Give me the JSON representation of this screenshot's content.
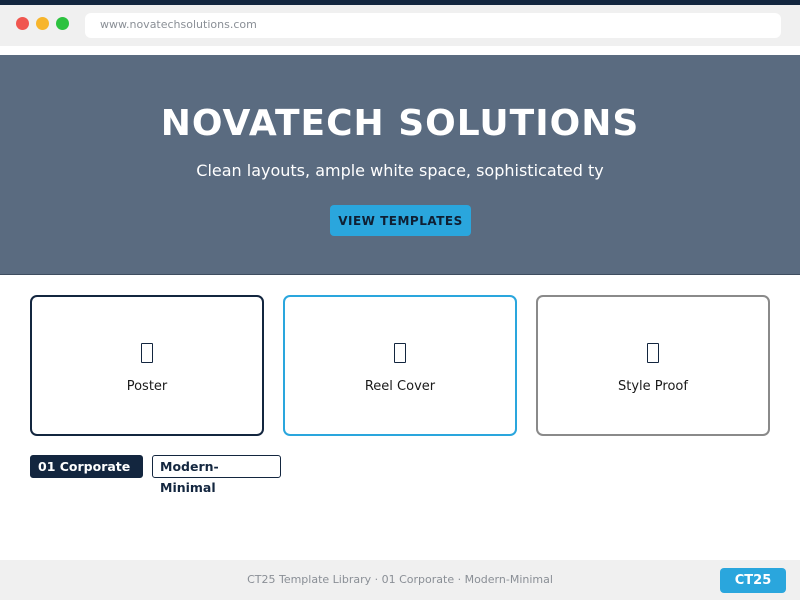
{
  "browser": {
    "url": "www.novatechsolutions.com"
  },
  "hero": {
    "title": "NOVATECH SOLUTIONS",
    "subtitle": "Clean layouts, ample white space, sophisticated ty",
    "button_label": "VIEW TEMPLATES"
  },
  "cards": [
    {
      "label": "Poster",
      "icon": "document-icon"
    },
    {
      "label": "Reel Cover",
      "icon": "document-icon"
    },
    {
      "label": "Style Proof",
      "icon": "document-icon"
    }
  ],
  "tags": [
    {
      "label": "01 Corporate"
    },
    {
      "label": "Modern-Minimal"
    }
  ],
  "footer": {
    "text": "CT25 Template Library · 01 Corporate · Modern-Minimal",
    "badge": "CT25"
  },
  "colors": {
    "navy": "#13263f",
    "accent": "#2aa6dd",
    "hero_bg": "#5a6b80",
    "gray_border": "#8a8a8a"
  }
}
